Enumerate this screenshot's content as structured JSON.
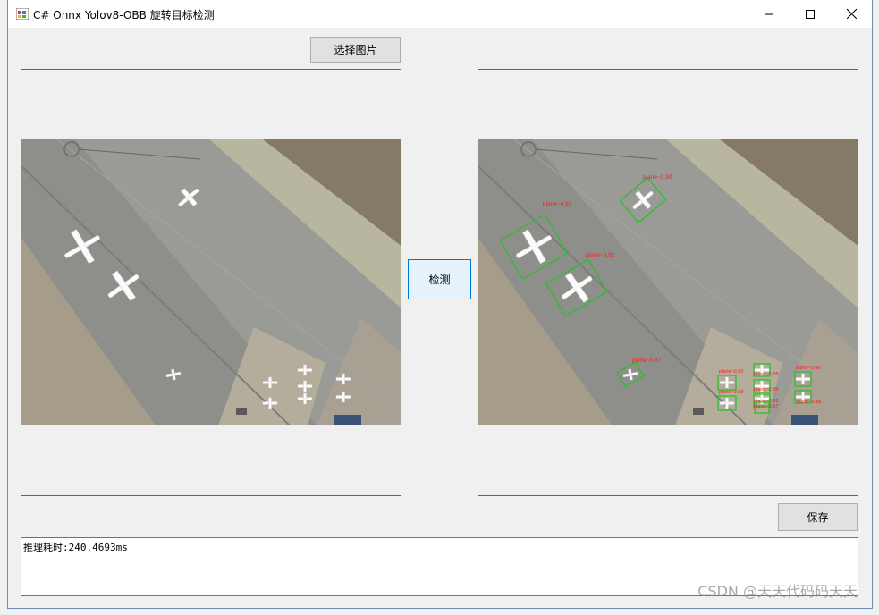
{
  "window": {
    "title": "C# Onnx Yolov8-OBB 旋转目标检测",
    "controls": {
      "minimize": "minimize",
      "maximize": "maximize",
      "close": "close"
    }
  },
  "buttons": {
    "select_image": "选择图片",
    "detect": "检测",
    "save": "保存"
  },
  "log": {
    "text": "推理耗时:240.4693ms"
  },
  "detections": [
    "plane~0.92",
    "plane~0.90",
    "plane~0.92",
    "plane~0.87",
    "plane~0.90",
    "plane~0.88",
    "plane~0.90",
    "plane~0.89",
    "plane~0.88",
    "plane~0.88",
    "plane~0.88",
    "plane~0.87"
  ],
  "colors": {
    "detection_box": "#22c322",
    "detection_label": "#ff1a1a",
    "accent": "#0078d7"
  },
  "watermark": "CSDN @天天代码码天天"
}
